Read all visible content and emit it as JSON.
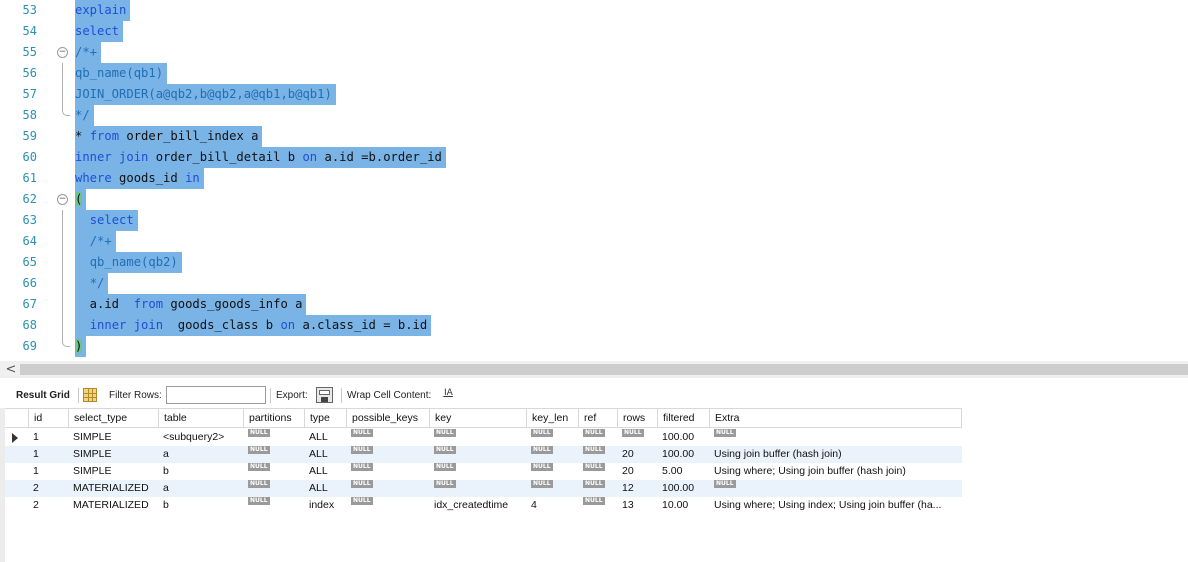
{
  "editor": {
    "lines": [
      {
        "n": "53",
        "fold": "",
        "selected": true,
        "segs": [
          {
            "t": "explain",
            "c": "kw"
          }
        ]
      },
      {
        "n": "54",
        "fold": "",
        "selected": true,
        "segs": [
          {
            "t": "select",
            "c": "kw"
          }
        ]
      },
      {
        "n": "55",
        "fold": "open",
        "selected": true,
        "segs": [
          {
            "t": "/*+",
            "c": "cm"
          }
        ]
      },
      {
        "n": "56",
        "fold": "line",
        "selected": true,
        "segs": [
          {
            "t": "qb_name(qb1)",
            "c": "cm"
          }
        ]
      },
      {
        "n": "57",
        "fold": "line",
        "selected": true,
        "segs": [
          {
            "t": "JOIN_ORDER(a@qb2,b@qb2,a@qb1,b@qb1)",
            "c": "cm"
          }
        ]
      },
      {
        "n": "58",
        "fold": "end",
        "selected": true,
        "segs": [
          {
            "t": "*/",
            "c": "cm"
          }
        ]
      },
      {
        "n": "59",
        "fold": "",
        "selected": true,
        "segs": [
          {
            "t": "* ",
            "c": ""
          },
          {
            "t": "from",
            "c": "kw"
          },
          {
            "t": " order_bill_index a",
            "c": ""
          }
        ]
      },
      {
        "n": "60",
        "fold": "",
        "selected": true,
        "segs": [
          {
            "t": "inner join",
            "c": "kw"
          },
          {
            "t": " order_bill_detail b ",
            "c": ""
          },
          {
            "t": "on",
            "c": "kw"
          },
          {
            "t": " a.id =b.order_id",
            "c": ""
          }
        ]
      },
      {
        "n": "61",
        "fold": "",
        "selected": true,
        "segs": [
          {
            "t": "where",
            "c": "kw"
          },
          {
            "t": " goods_id ",
            "c": ""
          },
          {
            "t": "in",
            "c": "kw"
          }
        ]
      },
      {
        "n": "62",
        "fold": "open",
        "selected": true,
        "segs": [
          {
            "t": "(",
            "c": "br"
          }
        ]
      },
      {
        "n": "63",
        "fold": "line",
        "selected": true,
        "segs": [
          {
            "t": "  ",
            "c": ""
          },
          {
            "t": "select",
            "c": "kw"
          }
        ]
      },
      {
        "n": "64",
        "fold": "line",
        "selected": true,
        "segs": [
          {
            "t": "  ",
            "c": ""
          },
          {
            "t": "/*+",
            "c": "cm"
          }
        ]
      },
      {
        "n": "65",
        "fold": "line",
        "selected": true,
        "segs": [
          {
            "t": "  ",
            "c": ""
          },
          {
            "t": "qb_name(qb2)",
            "c": "cm"
          }
        ]
      },
      {
        "n": "66",
        "fold": "line",
        "selected": true,
        "segs": [
          {
            "t": "  ",
            "c": ""
          },
          {
            "t": "*/",
            "c": "cm"
          }
        ]
      },
      {
        "n": "67",
        "fold": "line",
        "selected": true,
        "segs": [
          {
            "t": "  a.id  ",
            "c": ""
          },
          {
            "t": "from",
            "c": "kw"
          },
          {
            "t": " goods_goods_info a",
            "c": ""
          }
        ]
      },
      {
        "n": "68",
        "fold": "line",
        "selected": true,
        "segs": [
          {
            "t": "  ",
            "c": ""
          },
          {
            "t": "inner join",
            "c": "kw"
          },
          {
            "t": "  goods_class b ",
            "c": ""
          },
          {
            "t": "on",
            "c": "kw"
          },
          {
            "t": " a.class_id = b.id",
            "c": ""
          }
        ]
      },
      {
        "n": "69",
        "fold": "end",
        "selected": true,
        "segs": [
          {
            "t": ")",
            "c": "br"
          }
        ]
      }
    ]
  },
  "scrollbar": {
    "left_arrow": "<"
  },
  "toolbar": {
    "result_grid": "Result Grid",
    "result_grid_icon": "grid-icon",
    "filter_rows": "Filter Rows:",
    "filter_value": "",
    "export": "Export:",
    "export_icon": "export-icon",
    "wrap_cell": "Wrap Cell Content:",
    "wrap_icon_glyph": "I͟A"
  },
  "grid": {
    "null_label": "NULL",
    "columns": [
      "id",
      "select_type",
      "table",
      "partitions",
      "type",
      "possible_keys",
      "key",
      "key_len",
      "ref",
      "rows",
      "filtered",
      "Extra"
    ],
    "rows": [
      {
        "current": true,
        "cells": [
          "1",
          "SIMPLE",
          "<subquery2>",
          null,
          "ALL",
          null,
          null,
          null,
          null,
          null,
          "100.00",
          null
        ]
      },
      {
        "current": false,
        "cells": [
          "1",
          "SIMPLE",
          "a",
          null,
          "ALL",
          null,
          null,
          null,
          null,
          "20",
          "100.00",
          "Using join buffer (hash join)"
        ]
      },
      {
        "current": false,
        "cells": [
          "1",
          "SIMPLE",
          "b",
          null,
          "ALL",
          null,
          null,
          null,
          null,
          "20",
          "5.00",
          "Using where; Using join buffer (hash join)"
        ]
      },
      {
        "current": false,
        "cells": [
          "2",
          "MATERIALIZED",
          "a",
          null,
          "ALL",
          null,
          null,
          null,
          null,
          "12",
          "100.00",
          null
        ]
      },
      {
        "current": false,
        "cells": [
          "2",
          "MATERIALIZED",
          "b",
          null,
          "index",
          null,
          "idx_createdtime",
          "4",
          null,
          "13",
          "10.00",
          "Using where; Using index; Using join buffer (ha..."
        ]
      }
    ]
  },
  "colors": {
    "selection": "#7ab3e6",
    "keyword": "#1e4ed8",
    "comment": "#1f6fb5",
    "bracket_match": "#6fc38f",
    "line_number": "#2b91af",
    "alt_row": "#eaf2fb"
  }
}
